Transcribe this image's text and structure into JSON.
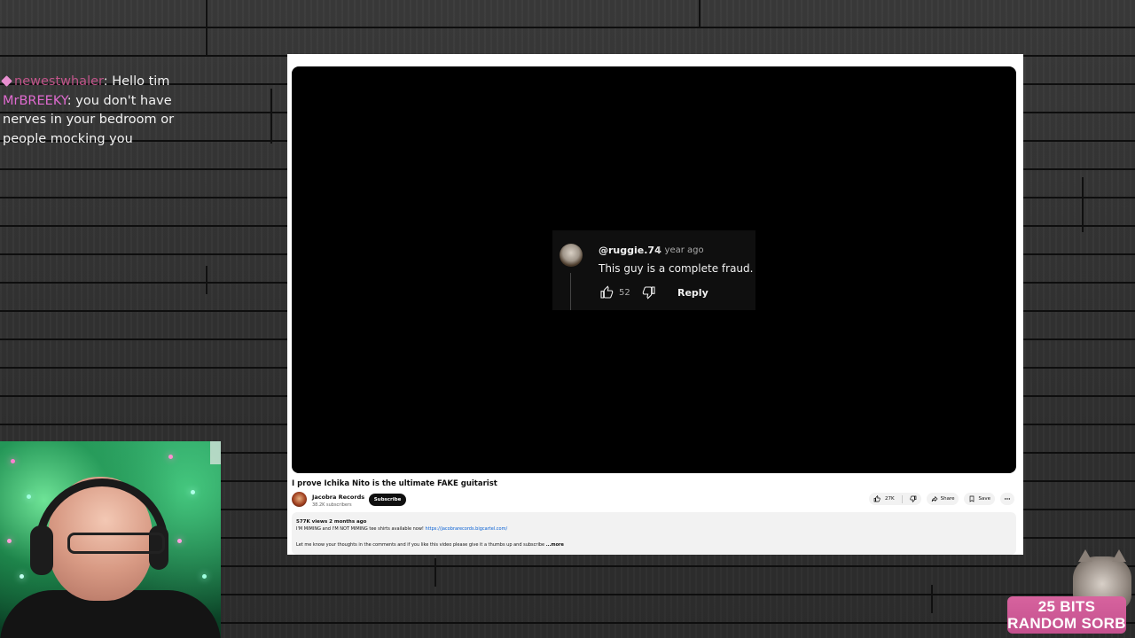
{
  "chat": {
    "messages": [
      {
        "username": "newestwhaler",
        "separator": ":",
        "text": " Hello tim"
      },
      {
        "username": "MrBREEKY",
        "separator": ":",
        "text": " you don't have nerves in your bedroom or people mocking you"
      }
    ]
  },
  "comment": {
    "handle": "@ruggie.74",
    "time": "1 year ago",
    "text": "This guy is a complete fraud.",
    "like_count": "52",
    "reply_label": "Reply"
  },
  "video": {
    "title": "I prove Ichika Nito is the ultimate FAKE guitarist",
    "channel_name": "Jacobra Records",
    "subscribers": "38.2K subscribers",
    "subscribe_label": "Subscribe",
    "likes": "27K",
    "share_label": "Share",
    "save_label": "Save",
    "more_icon": "more-horizontal-icon"
  },
  "description": {
    "meta": "577K views  2 months ago",
    "line1_prefix": "I'M MIMING and I'M NOT MIMING tee shirts available now! ",
    "line1_link": "https://jacobrarecords.bigcartel.com/",
    "line2": "Let me know your thoughts in the comments and if you like this video please give it a thumbs up and subscribe  ",
    "more_label": "...more"
  },
  "bits_overlay": {
    "line1": "25 BITS",
    "line2": "RANDOM SORB"
  },
  "colors": {
    "player_bg": "#000000",
    "comment_bg": "#0f0f0f",
    "link": "#065fd4",
    "bits_pink": "#d7639e",
    "chat_user1": "#c0558a",
    "chat_user2": "#e06bd0"
  }
}
